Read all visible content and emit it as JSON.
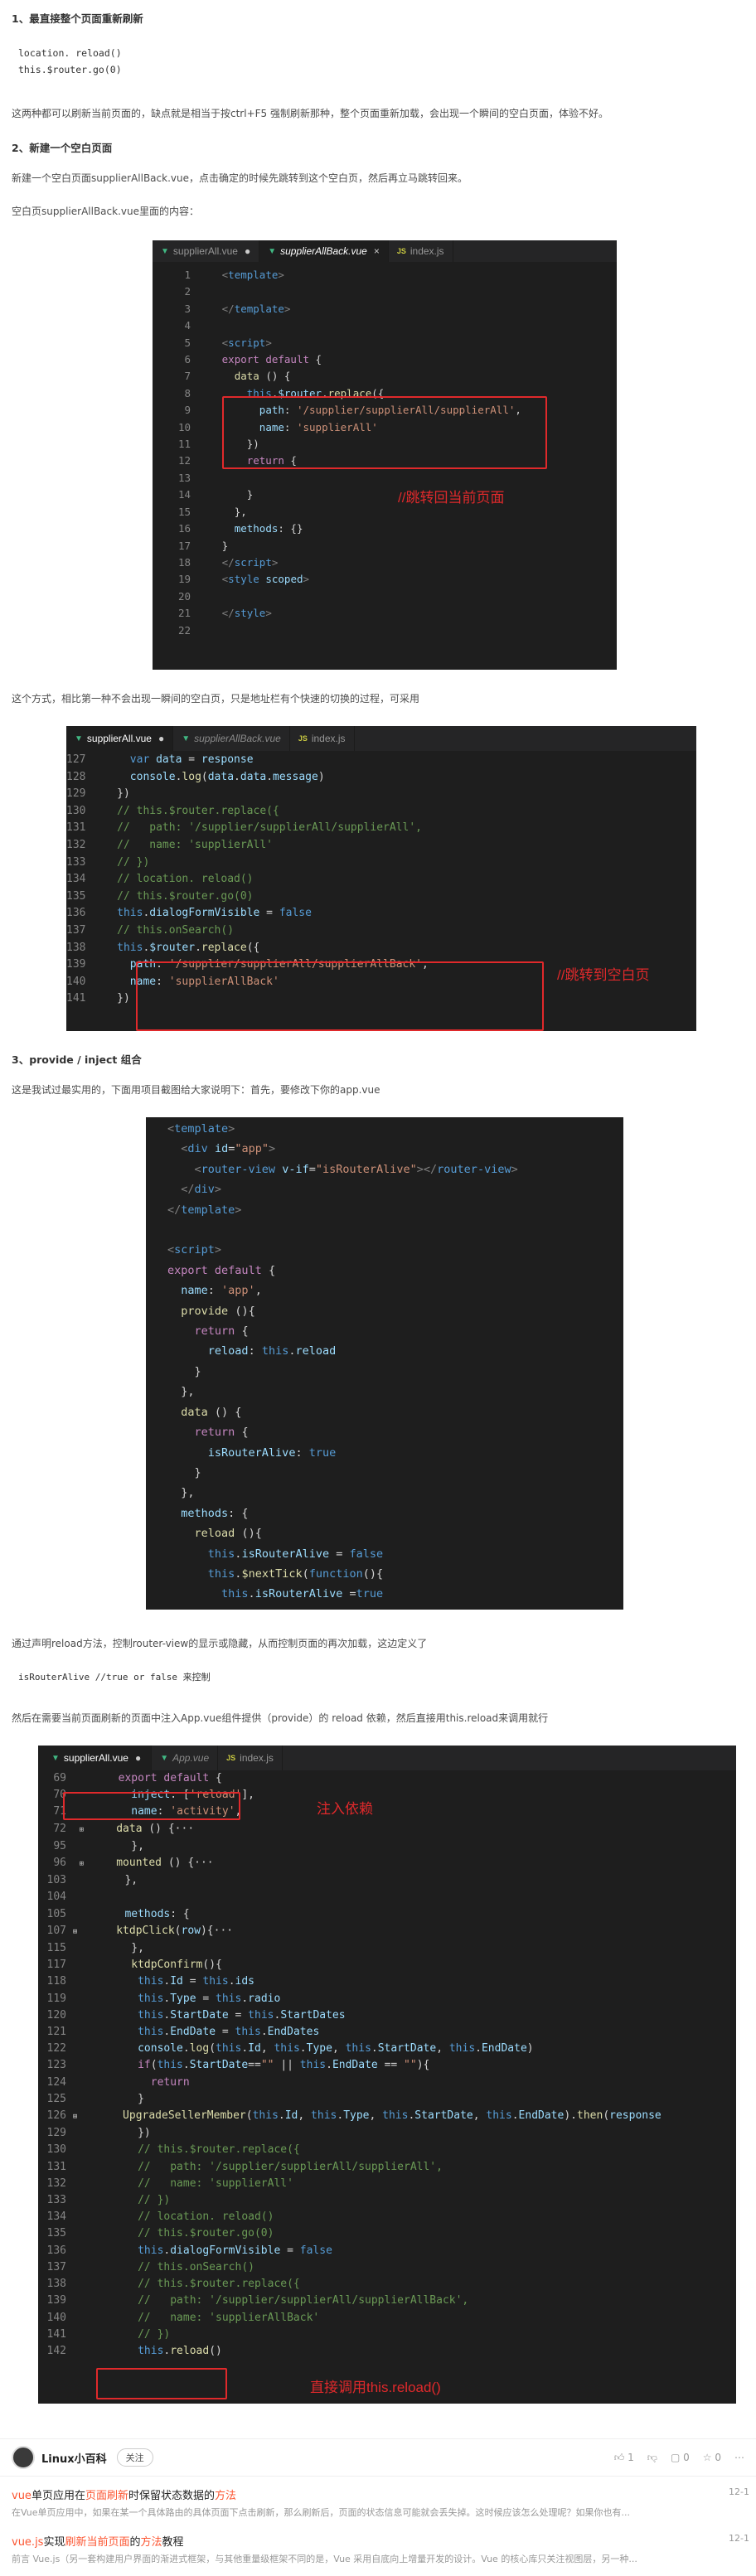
{
  "sections": {
    "s1_heading": "1、最直接整个页面重新刷新",
    "s1_code_line1": "location. reload()",
    "s1_code_line2": "this.$router.go(0)",
    "s1_desc": "这两种都可以刷新当前页面的，缺点就是相当于按ctrl+F5 强制刷新那种，整个页面重新加载，会出现一个瞬间的空白页面，体验不好。",
    "s2_heading": "2、新建一个空白页面",
    "s2_desc": "新建一个空白页面supplierAllBack.vue，点击确定的时候先跳转到这个空白页，然后再立马跳转回来。",
    "s2_desc2": "空白页supplierAllBack.vue里面的内容：",
    "s2_after": "这个方式，相比第一种不会出现一瞬间的空白页，只是地址栏有个快速的切换的过程，可采用",
    "s3_heading": "3、provide / inject 组合",
    "s3_desc": "这是我试过最实用的，下面用项目截图给大家说明下：首先，要修改下你的app.vue",
    "s3_desc2": "通过声明reload方法，控制router-view的显示或隐藏，从而控制页面的再次加载，这边定义了",
    "s3_code_snip": "isRouterAlive //true or false 来控制",
    "s3_desc3": "然后在需要当前页面刷新的页面中注入App.vue组件提供（provide）的 reload 依赖，然后直接用this.reload来调用就行"
  },
  "editor1": {
    "tabs": [
      {
        "label": "supplierAll.vue",
        "kind": "vue",
        "marker": "●",
        "active": false
      },
      {
        "label": "supplierAllBack.vue",
        "kind": "vue",
        "marker": "×",
        "active": true
      },
      {
        "label": "index.js",
        "kind": "js",
        "marker": "",
        "active": false
      }
    ],
    "annotation": "//跳转回当前页面"
  },
  "editor2": {
    "tabs": [
      {
        "label": "supplierAll.vue",
        "kind": "vue",
        "marker": "●",
        "active": true
      },
      {
        "label": "supplierAllBack.vue",
        "kind": "vue",
        "marker": "",
        "active": false
      },
      {
        "label": "index.js",
        "kind": "js",
        "marker": "",
        "active": false
      }
    ],
    "annotation": "//跳转到空白页"
  },
  "editor4": {
    "tabs": [
      {
        "label": "supplierAll.vue",
        "kind": "vue",
        "marker": "●",
        "active": true
      },
      {
        "label": "App.vue",
        "kind": "vue",
        "marker": "",
        "active": false
      },
      {
        "label": "index.js",
        "kind": "js",
        "marker": "",
        "active": false
      }
    ],
    "annotation_inject": "注入依赖",
    "annotation_reload": "直接调用this.reload()"
  },
  "author": {
    "name": "Linux小百科",
    "follow_label": "关注",
    "likes": "1",
    "comments": "0",
    "stars": "0"
  },
  "related": [
    {
      "title_pre": "vue",
      "title_mid": "单页应用在",
      "title_hl": "页面刷新",
      "title_post": "时保留状态数据的",
      "title_hl2": "方法",
      "date": "12-1",
      "desc": "在Vue单页应用中，如果在某一个具体路由的具体页面下点击刷新，那么刷新后，页面的状态信息可能就会丢失掉。这时候应该怎么处理呢？如果你也有..."
    },
    {
      "title_pre": "vue.js",
      "title_mid": "实现",
      "title_hl": "刷新当前页面",
      "title_post": "的",
      "title_hl2": "方法",
      "title_end": "教程",
      "date": "12-1",
      "desc": "前言 Vue.js（另一套构建用户界面的渐进式框架，与其他重量级框架不同的是，Vue 采用自底向上增量开发的设计。Vue 的核心库只关注视图层，另一种..."
    }
  ]
}
